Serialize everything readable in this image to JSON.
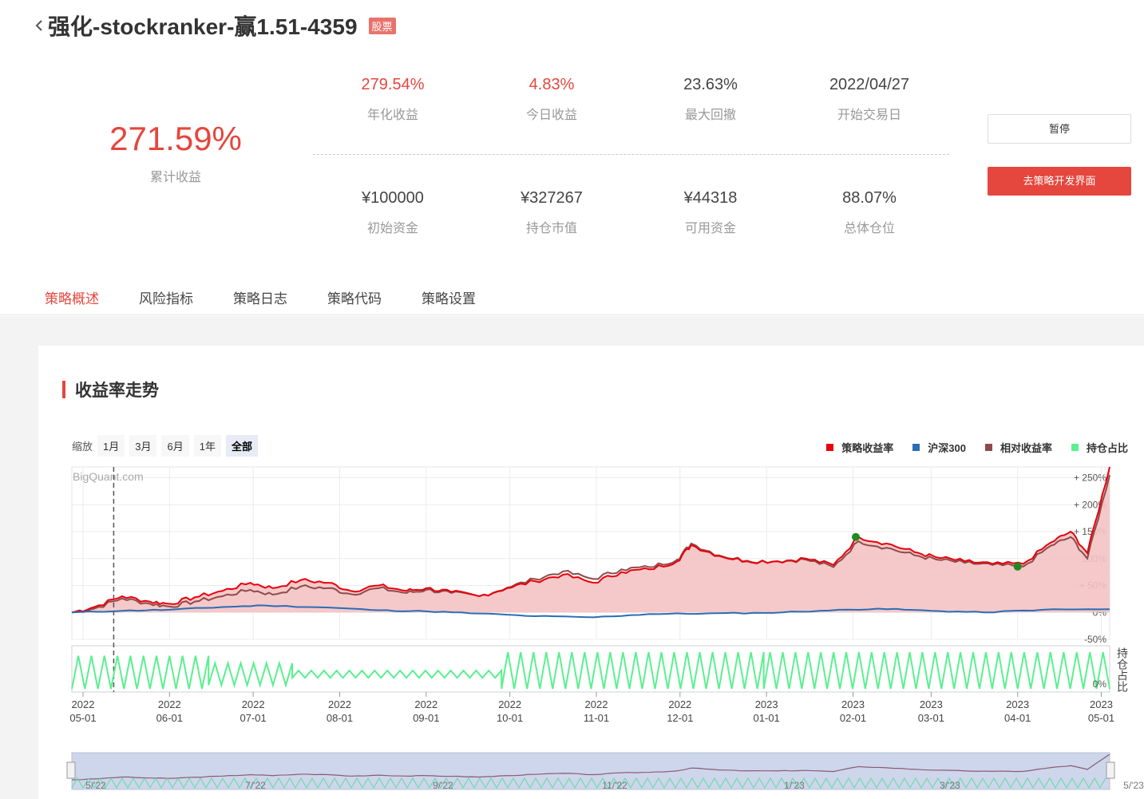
{
  "header": {
    "title": "强化-stockranker-赢1.51-4359",
    "badge": "股票"
  },
  "summary": {
    "cum_value": "271.59%",
    "cum_label": "累计收益"
  },
  "metrics": [
    {
      "value": "279.54%",
      "label": "年化收益"
    },
    {
      "value": "4.83%",
      "label": "今日收益"
    },
    {
      "value": "23.63%",
      "label": "最大回撤"
    },
    {
      "value": "2022/04/27",
      "label": "开始交易日"
    },
    {
      "value": "¥100000",
      "label": "初始资金"
    },
    {
      "value": "¥327267",
      "label": "持仓市值"
    },
    {
      "value": "¥44318",
      "label": "可用资金"
    },
    {
      "value": "88.07%",
      "label": "总体仓位"
    }
  ],
  "buttons": {
    "pause": "暂停",
    "dev": "去策略开发界面"
  },
  "tabs": [
    "策略概述",
    "风险指标",
    "策略日志",
    "策略代码",
    "策略设置"
  ],
  "section": {
    "title": "收益率走势"
  },
  "zoom": {
    "label": "缩放",
    "options": [
      "1月",
      "3月",
      "6月",
      "1年",
      "全部"
    ],
    "selected": "全部"
  },
  "colors": {
    "strategy": "#e8000b",
    "hs300": "#2a6db5",
    "relative": "#8e4b4b",
    "position": "#5af08f",
    "accent": "#e5463d"
  },
  "chart_data": {
    "type": "line",
    "watermark": "BigQuant.com",
    "legend": [
      "策略收益率",
      "沪深300",
      "相对收益率",
      "持仓占比"
    ],
    "y_ticks": [
      "+ 250%",
      "+ 200%",
      "+ 150%",
      "100%",
      "+ 50%",
      "0%",
      "-50%"
    ],
    "y_values": [
      250,
      200,
      150,
      100,
      50,
      0,
      -50
    ],
    "position_axis_label": "持仓占比",
    "position_tick": "0%",
    "x_ticks": [
      {
        "year": "2022",
        "date": "05-01"
      },
      {
        "year": "2022",
        "date": "06-01"
      },
      {
        "year": "2022",
        "date": "07-01"
      },
      {
        "year": "2022",
        "date": "08-01"
      },
      {
        "year": "2022",
        "date": "09-01"
      },
      {
        "year": "2022",
        "date": "10-01"
      },
      {
        "year": "2022",
        "date": "11-01"
      },
      {
        "year": "2022",
        "date": "12-01"
      },
      {
        "year": "2023",
        "date": "01-01"
      },
      {
        "year": "2023",
        "date": "02-01"
      },
      {
        "year": "2023",
        "date": "03-01"
      },
      {
        "year": "2023",
        "date": "04-01"
      },
      {
        "year": "2023",
        "date": "05-01"
      }
    ],
    "navigator_ticks": [
      "5/'22",
      "7/'22",
      "9/'22",
      "11/'22",
      "1/'23",
      "3/'23",
      "5/'23"
    ],
    "series": [
      {
        "name": "策略收益率",
        "x": [
          "2022-04-27",
          "2022-05-05",
          "2022-05-15",
          "2022-05-25",
          "2022-06-01",
          "2022-06-10",
          "2022-06-20",
          "2022-06-30",
          "2022-07-08",
          "2022-07-18",
          "2022-07-28",
          "2022-08-05",
          "2022-08-15",
          "2022-08-25",
          "2022-09-01",
          "2022-09-10",
          "2022-09-20",
          "2022-09-30",
          "2022-10-10",
          "2022-10-20",
          "2022-10-31",
          "2022-11-10",
          "2022-11-20",
          "2022-11-30",
          "2022-12-05",
          "2022-12-15",
          "2022-12-25",
          "2023-01-05",
          "2023-01-15",
          "2023-01-25",
          "2023-02-03",
          "2023-02-13",
          "2023-02-23",
          "2023-03-03",
          "2023-03-13",
          "2023-03-23",
          "2023-04-03",
          "2023-04-13",
          "2023-04-20",
          "2023-04-26",
          "2023-05-04"
        ],
        "values": [
          0,
          10,
          30,
          20,
          16,
          28,
          40,
          55,
          45,
          60,
          55,
          40,
          50,
          40,
          45,
          38,
          30,
          45,
          58,
          70,
          55,
          75,
          80,
          95,
          125,
          105,
          95,
          95,
          100,
          88,
          140,
          128,
          112,
          102,
          95,
          90,
          90,
          130,
          150,
          110,
          270
        ]
      },
      {
        "name": "沪深300",
        "x": [
          "2022-04-27",
          "2022-05-15",
          "2022-06-01",
          "2022-06-20",
          "2022-07-05",
          "2022-07-28",
          "2022-08-15",
          "2022-09-01",
          "2022-09-20",
          "2022-10-10",
          "2022-10-31",
          "2022-11-20",
          "2022-12-10",
          "2022-12-31",
          "2023-01-20",
          "2023-02-10",
          "2023-03-01",
          "2023-03-20",
          "2023-04-10",
          "2023-05-04"
        ],
        "values": [
          0,
          3,
          5,
          10,
          13,
          9,
          4,
          2,
          -2,
          -7,
          -9,
          -3,
          -2,
          -1,
          3,
          7,
          3,
          0,
          5,
          6
        ]
      },
      {
        "name": "相对收益率",
        "x": [
          "2022-04-27",
          "2022-05-05",
          "2022-05-15",
          "2022-05-25",
          "2022-06-01",
          "2022-06-10",
          "2022-06-20",
          "2022-06-30",
          "2022-07-08",
          "2022-07-18",
          "2022-07-28",
          "2022-08-05",
          "2022-08-15",
          "2022-08-25",
          "2022-09-01",
          "2022-09-10",
          "2022-09-20",
          "2022-09-30",
          "2022-10-10",
          "2022-10-20",
          "2022-10-31",
          "2022-11-10",
          "2022-11-20",
          "2022-11-30",
          "2022-12-05",
          "2022-12-15",
          "2022-12-25",
          "2023-01-05",
          "2023-01-15",
          "2023-01-25",
          "2023-02-03",
          "2023-02-13",
          "2023-02-23",
          "2023-03-03",
          "2023-03-13",
          "2023-03-23",
          "2023-04-03",
          "2023-04-13",
          "2023-04-20",
          "2023-04-26",
          "2023-05-04"
        ],
        "values": [
          0,
          7,
          26,
          16,
          11,
          20,
          30,
          42,
          33,
          48,
          45,
          34,
          45,
          36,
          42,
          36,
          30,
          46,
          62,
          76,
          62,
          80,
          84,
          98,
          128,
          106,
          96,
          95,
          98,
          84,
          132,
          120,
          106,
          98,
          92,
          88,
          85,
          124,
          140,
          100,
          255
        ]
      },
      {
        "name": "持仓占比",
        "segments": [
          {
            "from": "2022-04-27",
            "to": "2022-06-15",
            "low": 0,
            "high": 90
          },
          {
            "from": "2022-06-15",
            "to": "2022-07-15",
            "low": 10,
            "high": 70
          },
          {
            "from": "2022-07-15",
            "to": "2022-09-28",
            "low": 30,
            "high": 50
          },
          {
            "from": "2022-09-28",
            "to": "2022-12-31",
            "low": 0,
            "high": 100
          },
          {
            "from": "2022-12-31",
            "to": "2023-04-01",
            "low": 0,
            "high": 100
          },
          {
            "from": "2023-04-01",
            "to": "2023-05-04",
            "low": 0,
            "high": 100
          }
        ]
      }
    ],
    "markers": [
      {
        "x": "2023-02-02",
        "y": 140
      },
      {
        "x": "2023-04-01",
        "y": 85
      }
    ],
    "crosshair_x": "2022-05-12"
  }
}
